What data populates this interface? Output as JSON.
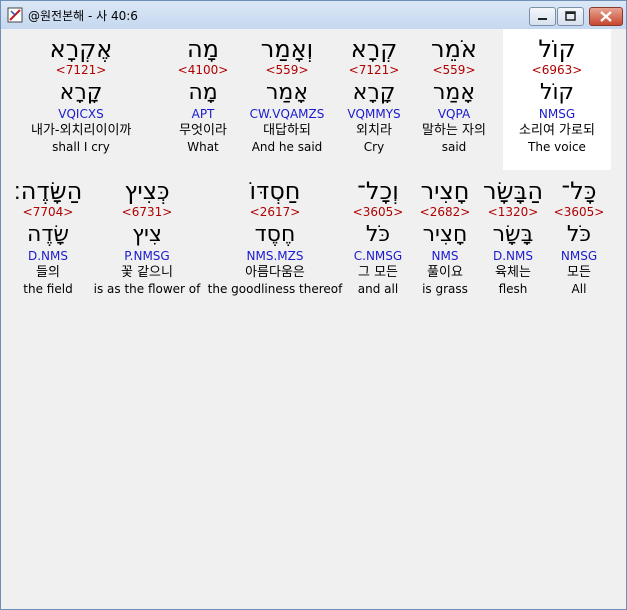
{
  "window": {
    "title": "@원전본해 - 사 40:6",
    "icon": "bible-app-icon",
    "controls": [
      "minimize-icon",
      "maximize-icon",
      "close-icon"
    ]
  },
  "rows": [
    {
      "words": [
        {
          "heb": "אֶקְרָא",
          "strong": "<7121>",
          "lex": "קָרָא",
          "parse": "VQICXS",
          "kor": "내가-외치리이이까",
          "eng": "shall I cry"
        },
        {
          "heb": "מָה",
          "strong": "<4100>",
          "lex": "מָה",
          "parse": "APT",
          "kor": "무엇이라",
          "eng": "What"
        },
        {
          "heb": "וְאָמַר",
          "strong": "<559>",
          "lex": "אָמַר",
          "parse": "CW.VQAMZS",
          "kor": "대답하되",
          "eng": "And he said"
        },
        {
          "heb": "קְרָא",
          "strong": "<7121>",
          "lex": "קָרָא",
          "parse": "VQMMYS",
          "kor": "외치라",
          "eng": "Cry"
        },
        {
          "heb": "אֹמֵר",
          "strong": "<559>",
          "lex": "אָמַר",
          "parse": "VQPA",
          "kor": "말하는 자의",
          "eng": "said"
        },
        {
          "heb": "קוֹל",
          "strong": "<6963>",
          "lex": "קוֹל",
          "parse": "NMSG",
          "kor": "소리여 가로되",
          "eng": "The voice"
        }
      ]
    },
    {
      "words": [
        {
          "heb": "הַשָּׂדֶה׃",
          "strong": "<7704>",
          "lex": "שָׂדֶה",
          "parse": "D.NMS",
          "kor": "들의",
          "eng": "the field"
        },
        {
          "heb": "כְּצִיץ",
          "strong": "<6731>",
          "lex": "צִיץ",
          "parse": "P.NMSG",
          "kor": "꽃 같으니",
          "eng": "is as the flower of"
        },
        {
          "heb": "חַסְדּוֹ",
          "strong": "<2617>",
          "lex": "חֶסֶד",
          "parse": "NMS.MZS",
          "kor": "아름다움은",
          "eng": "the goodliness thereof"
        },
        {
          "heb": "וְכָל־",
          "strong": "<3605>",
          "lex": "כֹּל",
          "parse": "C.NMSG",
          "kor": "그 모든",
          "eng": "and all"
        },
        {
          "heb": "חָצִיר",
          "strong": "<2682>",
          "lex": "חָצִיר",
          "parse": "NMS",
          "kor": "풀이요",
          "eng": "is grass"
        },
        {
          "heb": "הַבָּשָׂר",
          "strong": "<1320>",
          "lex": "בָּשָׂר",
          "parse": "D.NMS",
          "kor": "육체는",
          "eng": "flesh"
        },
        {
          "heb": "כָּל־",
          "strong": "<3605>",
          "lex": "כֹּל",
          "parse": "NMSG",
          "kor": "모든",
          "eng": "All"
        }
      ]
    }
  ],
  "colors": {
    "strong_number": "#b00000",
    "parsing_code": "#1a1ad0",
    "highlight": "#ffffff"
  }
}
